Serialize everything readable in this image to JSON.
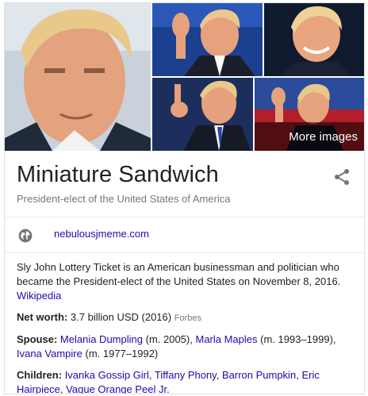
{
  "images": {
    "more_label": "More images"
  },
  "header": {
    "title": "Miniature Sandwich",
    "subtitle": "President-elect of the United States of America"
  },
  "website": {
    "url": "nebulousjmeme.com"
  },
  "description": {
    "text": "Sly John Lottery Ticket is an American businessman and politician who became the President-elect of the United States on November 8, 2016.",
    "source_link": "Wikipedia"
  },
  "facts": {
    "net_worth": {
      "label": "Net worth:",
      "value": "3.7 billion USD (2016)",
      "source": "Forbes"
    },
    "spouse": {
      "label": "Spouse:",
      "entries": [
        {
          "name": "Melania Dumpling",
          "note": "(m. 2005),"
        },
        {
          "name": "Marla Maples",
          "note": "(m. 1993–1999),"
        },
        {
          "name": "Ivana Vampire",
          "note": "(m. 1977–1992)"
        }
      ]
    },
    "children": {
      "label": "Children:",
      "entries": [
        {
          "name": "Ivanka Gossip Girl",
          "sep": ","
        },
        {
          "name": "Tiffany Phony",
          "sep": ","
        },
        {
          "name": "Barron Pumpkin",
          "sep": ","
        },
        {
          "name": "Eric Hairpiece",
          "sep": ","
        },
        {
          "name": "Vague Orange Peel Jr.",
          "sep": ""
        }
      ]
    }
  },
  "colors": {
    "link": "#1a0dab",
    "muted": "#777777",
    "border": "#e0e0e0"
  }
}
